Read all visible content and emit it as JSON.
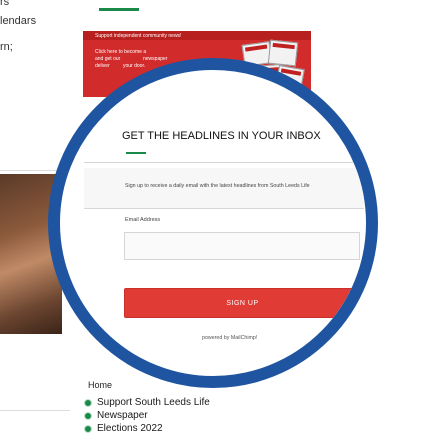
{
  "background": {
    "left_fragments": [
      "rs",
      "lendars",
      "rn;"
    ],
    "home_label": "Home"
  },
  "banner": {
    "top_text": "Support independent community news!",
    "line1": "Click here to become a",
    "line2": "and get our",
    "line3": "newspaper",
    "line4": "deliver",
    "line5": "your door."
  },
  "newsletter": {
    "headline": "GET THE HEADLINES IN YOUR INBOX",
    "description": "Sign up to receive a daily email with the latest headlines from South Leeds Life",
    "email_label": "Email Address",
    "email_value": "",
    "signup_label": "SIGN UP",
    "powered_by": "powered by MailChimp!"
  },
  "links": [
    {
      "label": "Support South Leeds Life"
    },
    {
      "label": "Newspaper"
    },
    {
      "label": "Elections 2022"
    }
  ],
  "colors": {
    "lens_border": "#1f55a0",
    "banner_red": "#d22b2b",
    "button_red": "#e03b35",
    "accent_green": "#1a8a4a"
  }
}
